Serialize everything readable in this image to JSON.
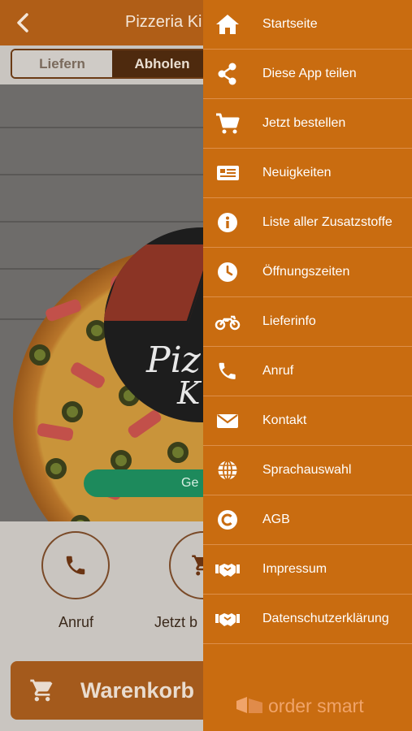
{
  "header": {
    "title": "Pizzeria Ki"
  },
  "order_mode": {
    "deliver": "Liefern",
    "pickup": "Abholen",
    "selected": "Abholen"
  },
  "hero": {
    "logo_text_line1": "Piz",
    "logo_text_line2": "K",
    "status_badge": "Ge"
  },
  "actions": {
    "call_label": "Anruf",
    "order_label": "Jetzt b"
  },
  "cart_bar": {
    "label": "Warenkorb"
  },
  "drawer": {
    "items": [
      {
        "label": "Startseite",
        "icon": "home-icon"
      },
      {
        "label": "Diese App teilen",
        "icon": "share-icon"
      },
      {
        "label": "Jetzt bestellen",
        "icon": "cart-icon"
      },
      {
        "label": "Neuigkeiten",
        "icon": "newspaper-icon"
      },
      {
        "label": "Liste aller Zusatzstoffe",
        "icon": "info-icon"
      },
      {
        "label": "Öffnungszeiten",
        "icon": "clock-icon"
      },
      {
        "label": "Lieferinfo",
        "icon": "motorcycle-icon"
      },
      {
        "label": "Anruf",
        "icon": "phone-icon"
      },
      {
        "label": "Kontakt",
        "icon": "envelope-icon"
      },
      {
        "label": "Sprachauswahl",
        "icon": "globe-icon"
      },
      {
        "label": "AGB",
        "icon": "copyright-icon"
      },
      {
        "label": "Impressum",
        "icon": "handshake-icon"
      },
      {
        "label": "Datenschutzerklärung",
        "icon": "handshake-icon"
      }
    ],
    "brand": "order smart"
  },
  "colors": {
    "drawer_background": "#c96c10",
    "header_background": "#b05e17",
    "status_green": "#1d8a5c",
    "brand_text": "#f0a46a"
  }
}
